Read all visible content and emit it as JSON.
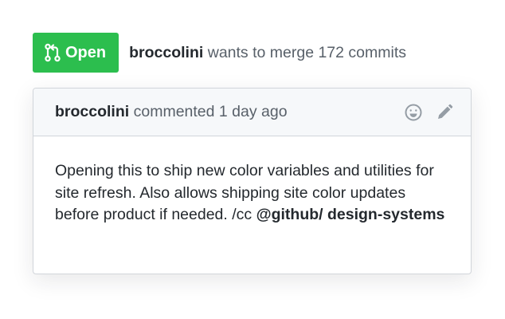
{
  "pull_request": {
    "state_label": "Open",
    "state_color": "#2cbe4e",
    "author": "broccolini",
    "summary": "wants to merge 172 commits"
  },
  "comment": {
    "author": "broccolini",
    "action": "commented",
    "time": "1 day ago",
    "body_text": "Opening this to ship new color variables and utilities for site refresh. Also allows shipping site color updates before product if needed. /cc ",
    "mention": "@github/ design-systems",
    "icons": [
      "smiley-icon",
      "pencil-icon"
    ]
  }
}
